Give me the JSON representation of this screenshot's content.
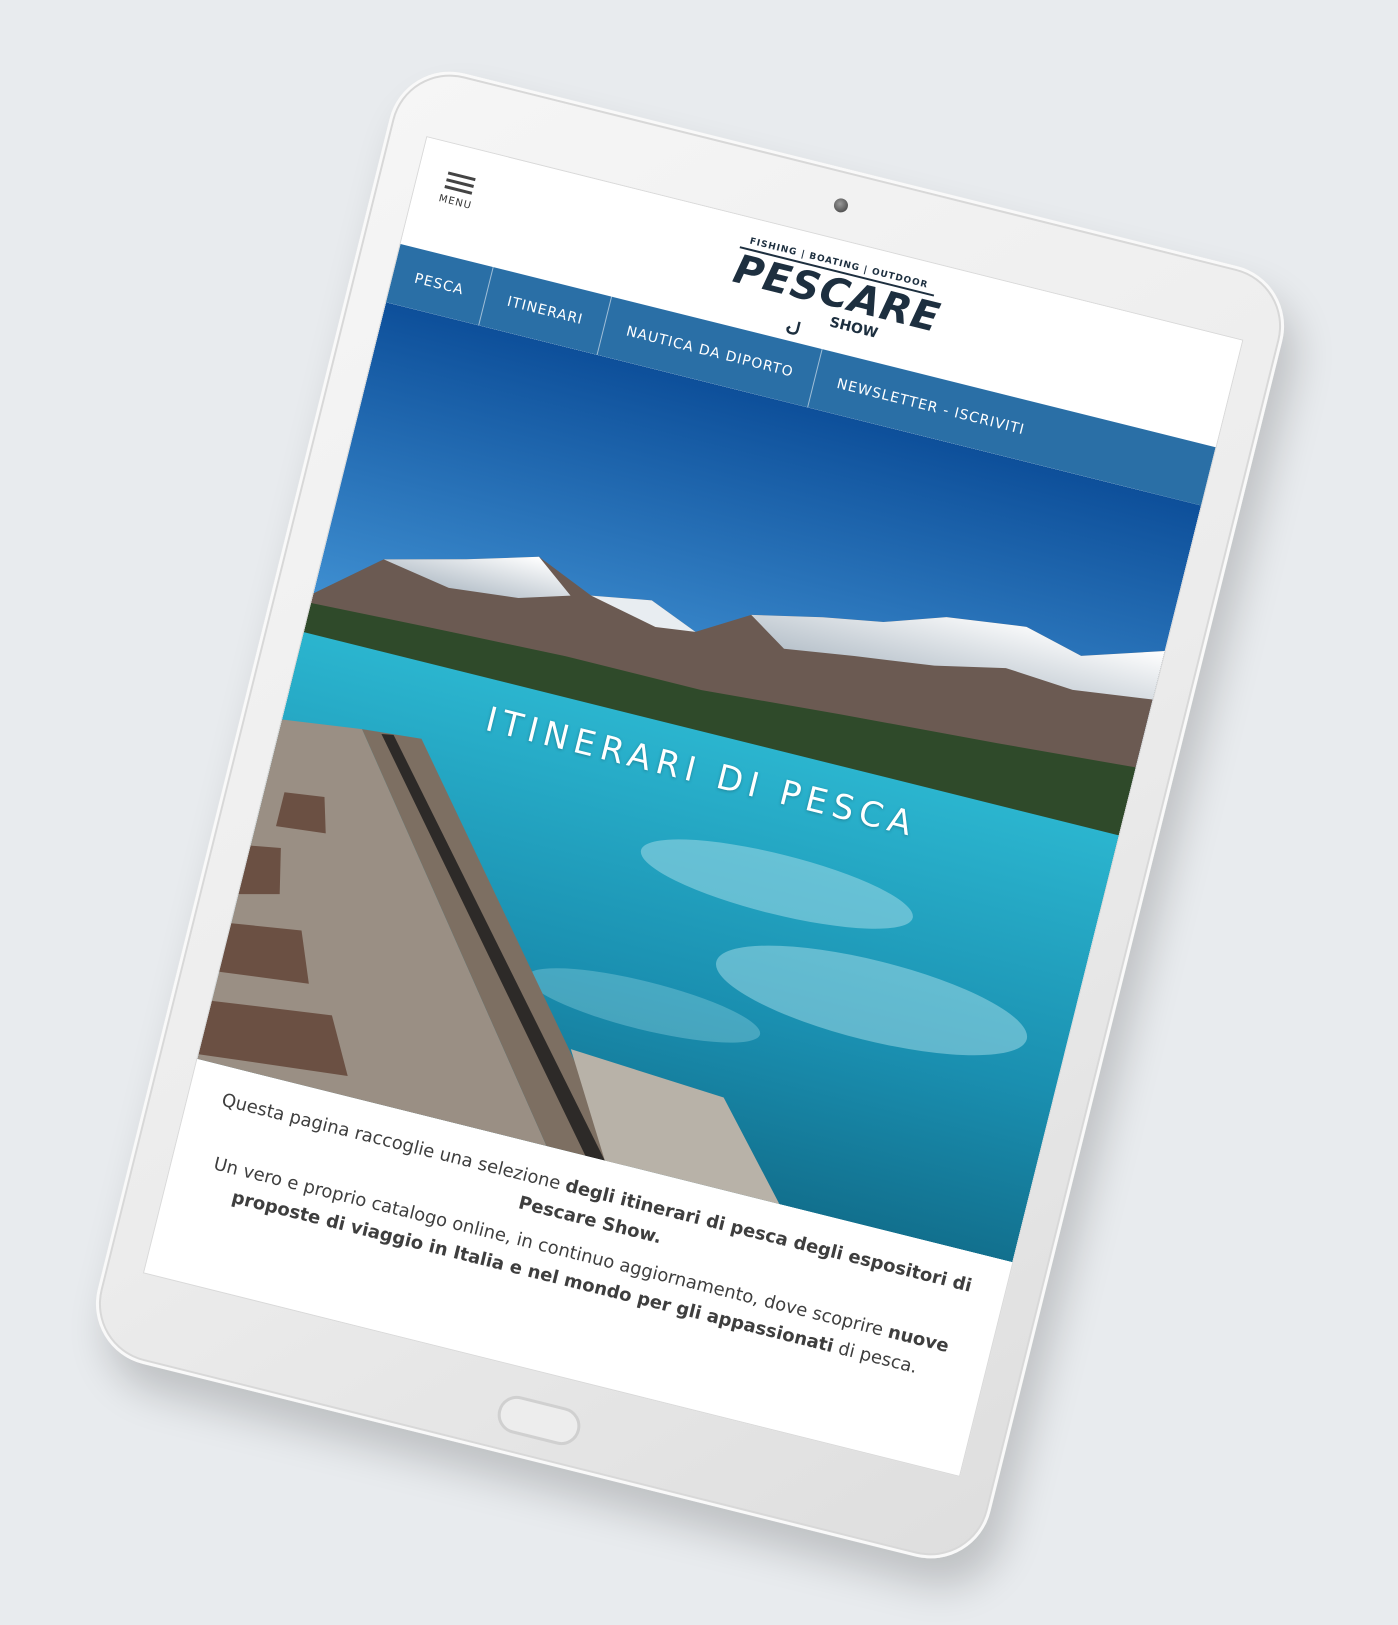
{
  "header": {
    "menu_label": "MENU",
    "logo": {
      "tagline": "FISHING | BOATING | OUTDOOR",
      "name": "PESCARE",
      "sub": "SHOW"
    }
  },
  "nav": {
    "items": [
      {
        "label": "PESCA"
      },
      {
        "label": "ITINERARI"
      },
      {
        "label": "NAUTICA DA DIPORTO"
      },
      {
        "label": "NEWSLETTER - ISCRIVITI"
      }
    ]
  },
  "hero": {
    "title": "ITINERARI DI PESCA"
  },
  "intro": {
    "line1_prefix": "Questa pagina raccoglie una selezione ",
    "line1_bold": "degli itinerari di pesca degli espositori di Pescare Show.",
    "line2_prefix": "Un vero e proprio catalogo online, in continuo aggiornamento, dove scoprire ",
    "line2_bold": "nuove proposte di viaggio in Italia e nel mondo per gli appassionati",
    "line2_suffix": " di pesca."
  },
  "colors": {
    "background": "#e8ebee",
    "nav": "#2a6fa6",
    "brand_dark": "#1d2f3f",
    "text": "#3e3e3e"
  }
}
